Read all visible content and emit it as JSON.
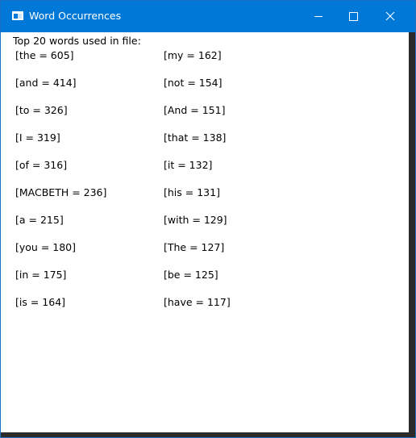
{
  "window": {
    "title": "Word Occurrences",
    "accent_color": "#0078d7",
    "icons": {
      "app": "app-window-icon",
      "minimize": "minimize-icon",
      "maximize": "maximize-icon",
      "close": "close-icon"
    }
  },
  "content": {
    "header": "Top 20 words used in file:",
    "left_column": [
      "[the = 605]",
      "[and = 414]",
      "[to = 326]",
      "[I = 319]",
      "[of = 316]",
      "[MACBETH = 236]",
      "[a = 215]",
      "[you = 180]",
      "[in = 175]",
      "[is = 164]"
    ],
    "right_column": [
      "[my = 162]",
      "[not = 154]",
      "[And = 151]",
      "[that = 138]",
      "[it = 132]",
      "[his = 131]",
      "[with = 129]",
      "[The = 127]",
      "[be = 125]",
      "[have = 117]"
    ]
  }
}
